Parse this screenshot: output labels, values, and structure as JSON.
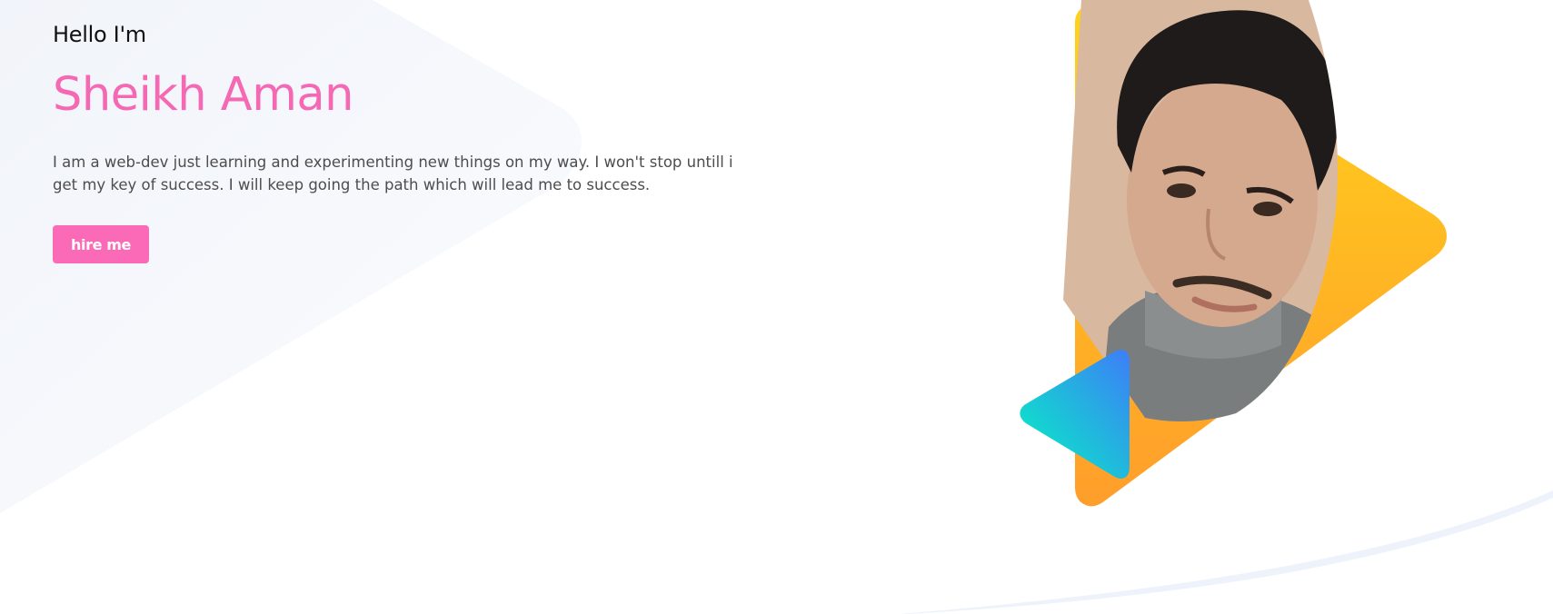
{
  "hero": {
    "greeting": "Hello I'm",
    "name": "Sheikh Aman",
    "bio": "I am a web-dev just learning and experimenting new things on my way. I won't stop untill i get my key of success. I will keep going the path which will lead me to success.",
    "cta_label": "hire me"
  },
  "colors": {
    "accent": "#f568b3",
    "button": "#fb6ab6",
    "triangle_top": "#ffd21a",
    "triangle_bottom": "#ff9f2b",
    "small_triangle_top": "#3b82f6",
    "small_triangle_bottom": "#06f0c3",
    "background_shape": "#f3f6fb"
  }
}
